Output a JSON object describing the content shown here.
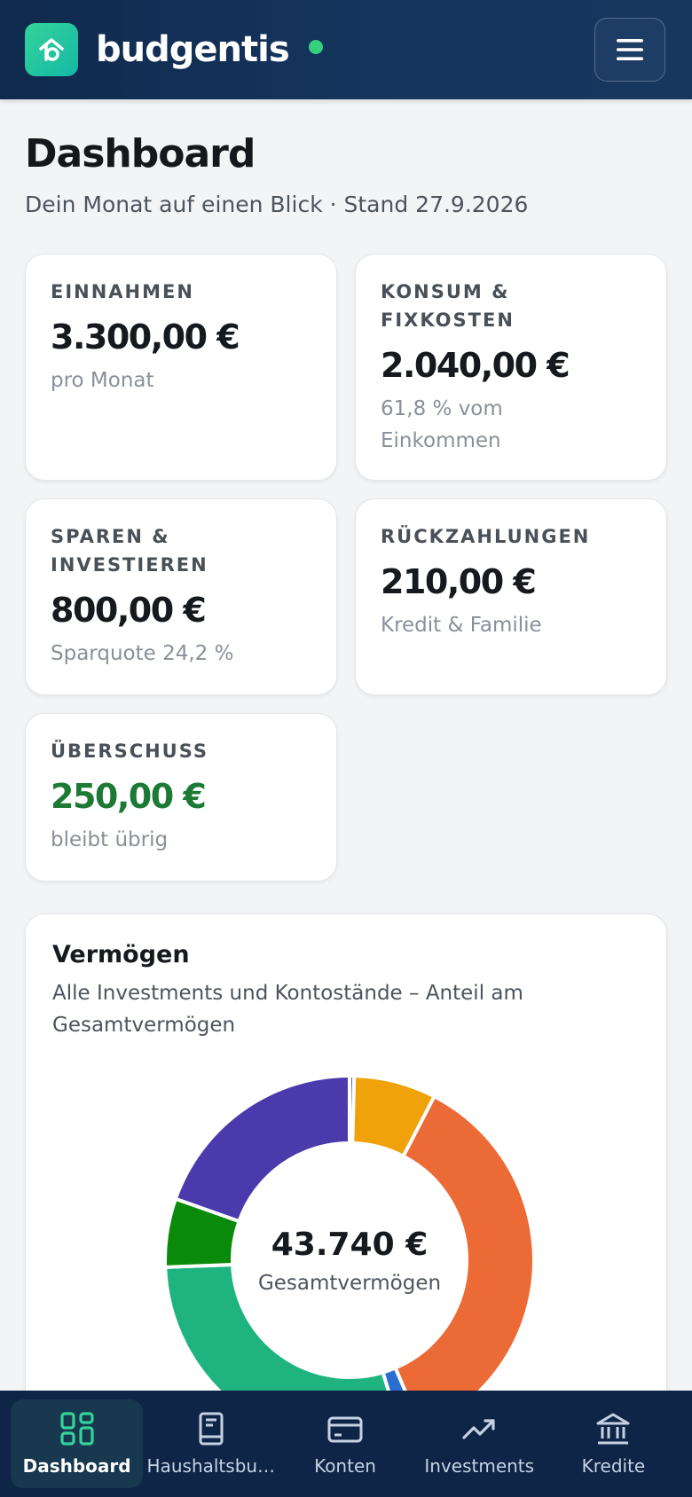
{
  "app": {
    "name": "budgentis",
    "status_color": "#34d07c",
    "menu_icon": "hamburger-menu-icon"
  },
  "page": {
    "title": "Dashboard",
    "subtitle": "Dein Monat auf einen Blick · Stand 27.9.2026"
  },
  "cards": [
    {
      "label": "EINNAHMEN",
      "value": "3.300,00 €",
      "sub": "pro Monat"
    },
    {
      "label": "KONSUM & FIXKOSTEN",
      "value": "2.040,00 €",
      "sub": "61,8 % vom Einkommen"
    },
    {
      "label": "SPAREN & INVESTIEREN",
      "value": "800,00 €",
      "sub": "Sparquote 24,2 %"
    },
    {
      "label": "RÜCKZAHLUNGEN",
      "value": "210,00 €",
      "sub": "Kredit & Familie"
    },
    {
      "label": "ÜBERSCHUSS",
      "value": "250,00 €",
      "sub": "bleibt übrig",
      "value_color": "#1c7a34"
    }
  ],
  "wealth": {
    "title": "Vermögen",
    "subtitle": "Alle Investments und Kontostände – Anteil am Gesamtvermögen",
    "total": "43.740 €",
    "total_label": "Gesamtvermögen",
    "segments": [
      {
        "fraction": 0.004,
        "color": "#6d5bd0"
      },
      {
        "fraction": 0.072,
        "color": "#efa20a"
      },
      {
        "fraction": 0.36,
        "color": "#ec6a35"
      },
      {
        "fraction": 0.018,
        "color": "#2a6fd0"
      },
      {
        "fraction": 0.29,
        "color": "#1eb37f"
      },
      {
        "fraction": 0.06,
        "color": "#0a8a0a"
      },
      {
        "fraction": 0.196,
        "color": "#4b3aab"
      }
    ]
  },
  "nav": [
    {
      "label": "Dashboard",
      "icon": "dashboard-grid-icon",
      "active": true
    },
    {
      "label": "Haushaltsbu…",
      "icon": "book-icon",
      "active": false
    },
    {
      "label": "Konten",
      "icon": "credit-card-icon",
      "active": false
    },
    {
      "label": "Investments",
      "icon": "trending-up-icon",
      "active": false
    },
    {
      "label": "Kredite",
      "icon": "bank-icon",
      "active": false
    }
  ]
}
